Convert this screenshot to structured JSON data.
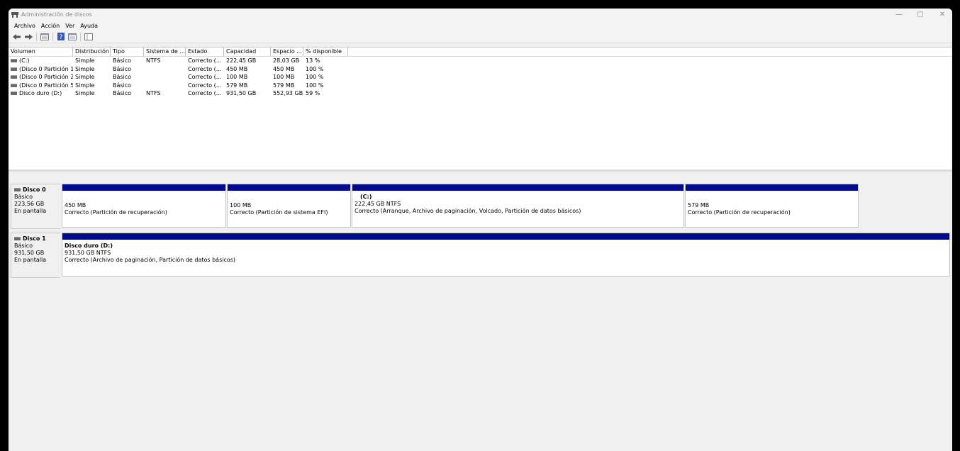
{
  "window": {
    "title": "Administración de discos",
    "controls": {
      "minimize": "—",
      "maximize": "▢",
      "close": "✕"
    }
  },
  "menu": [
    "Archivo",
    "Acción",
    "Ver",
    "Ayuda"
  ],
  "toolbar": {
    "icons": [
      "back-icon",
      "forward-icon",
      "disk-list-icon",
      "help-icon",
      "properties-icon",
      "console-icon"
    ]
  },
  "volumes": {
    "columns": [
      "Volumen",
      "Distribución",
      "Tipo",
      "Sistema de ...",
      "Estado",
      "Capacidad",
      "Espacio ...",
      "% disponible"
    ],
    "rows": [
      [
        "(C:)",
        "Simple",
        "Básico",
        "NTFS",
        "Correcto (...",
        "222,45 GB",
        "28,03 GB",
        "13 %"
      ],
      [
        "(Disco 0 Partición 1)",
        "Simple",
        "Básico",
        "",
        "Correcto (...",
        "450 MB",
        "450 MB",
        "100 %"
      ],
      [
        "(Disco 0 Partición 2)",
        "Simple",
        "Básico",
        "",
        "Correcto (...",
        "100 MB",
        "100 MB",
        "100 %"
      ],
      [
        "(Disco 0 Partición 5)",
        "Simple",
        "Básico",
        "",
        "Correcto (...",
        "579 MB",
        "579 MB",
        "100 %"
      ],
      [
        "Disco duro (D:)",
        "Simple",
        "Básico",
        "NTFS",
        "Correcto (...",
        "931,50 GB",
        "552,93 GB",
        "59 %"
      ]
    ]
  },
  "disks": [
    {
      "name": "Disco 0",
      "type": "Básico",
      "size": "223,56 GB",
      "status": "En pantalla",
      "partitions": [
        {
          "label": "",
          "size": "450 MB",
          "state": "Correcto (Partición de recuperación)"
        },
        {
          "label": "",
          "size": "100 MB",
          "state": "Correcto (Partición de sistema EFI)"
        },
        {
          "label": "(C:)",
          "size": "222,45 GB NTFS",
          "state": "Correcto (Arranque, Archivo de paginación, Volcado, Partición de datos básicos)"
        },
        {
          "label": "",
          "size": "579 MB",
          "state": "Correcto (Partición de recuperación)"
        }
      ]
    },
    {
      "name": "Disco 1",
      "type": "Básico",
      "size": "931,50 GB",
      "status": "En pantalla",
      "partitions": [
        {
          "label": "Disco duro  (D:)",
          "size": "931,50 GB NTFS",
          "state": "Correcto (Archivo de paginación, Partición de datos básicos)"
        }
      ]
    }
  ]
}
